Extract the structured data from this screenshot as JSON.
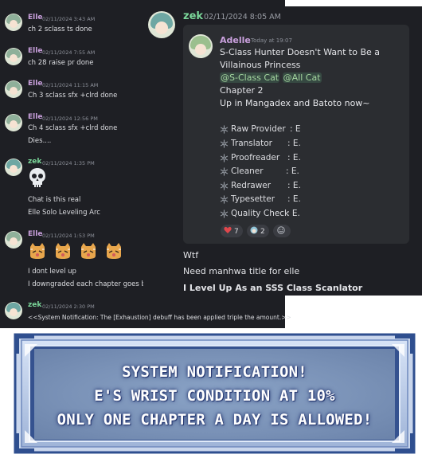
{
  "back_chat": {
    "messages": [
      {
        "author": "Elle",
        "timestamp": "02/11/2024 3:43 AM",
        "lines": [
          "ch 2 sclass ts done"
        ]
      },
      {
        "author": "Elle",
        "timestamp": "02/11/2024 7:55 AM",
        "lines": [
          "ch 28 raise pr done"
        ]
      },
      {
        "author": "Elle",
        "timestamp": "02/11/2024 11:15 AM",
        "lines": [
          "Ch 3 sclass sfx +clrd done"
        ]
      },
      {
        "author": "Elle",
        "timestamp": "02/11/2024 12:56 PM",
        "lines": [
          "Ch 4 sclass sfx +clrd done",
          "Dies...."
        ]
      },
      {
        "author": "zek",
        "timestamp": "02/11/2024 1:35 PM",
        "emoji": "skull-emoji",
        "lines": [
          "Chat is this real",
          "Elle Solo Leveling Arc"
        ]
      },
      {
        "author": "Elle",
        "timestamp": "02/11/2024 1:53 PM",
        "emoji": "cat-emoji x4",
        "lines": [
          "I dont level up",
          "I downgraded each chapter goes by"
        ]
      },
      {
        "author": "zek",
        "timestamp": "02/11/2024 2:30 PM",
        "lines": [
          "<<System Notification: The  [Exhaustion] debuff has been applied triple the amount.>>"
        ]
      }
    ]
  },
  "front_chat": {
    "author": "zek",
    "timestamp": "02/11/2024 8:05 AM",
    "embed": {
      "author": "Adelle",
      "timestamp": "Today at 19:07",
      "title_lines": [
        "S-Class Hunter Doesn't Want to Be a",
        "Villainous Princess"
      ],
      "mentions": [
        "@S-Class Cat",
        "@All Cat"
      ],
      "chapter": "Chapter 2",
      "announcement": "Up in Mangadex and Batoto now~",
      "roles": [
        {
          "name": "Raw Provider",
          "value": ": E"
        },
        {
          "name": "Translator",
          "value": ": E."
        },
        {
          "name": "Proofreader",
          "value": ": E."
        },
        {
          "name": "Cleaner",
          "value": ": E."
        },
        {
          "name": "Redrawer",
          "value": ": E."
        },
        {
          "name": "Typesetter",
          "value": ": E."
        },
        {
          "name": "Quality Check",
          "value": ": E."
        }
      ],
      "reactions": [
        {
          "icon": "heart-icon",
          "count": "7"
        },
        {
          "icon": "character-emoji-icon",
          "count": "2"
        },
        {
          "icon": "add-reaction-icon",
          "count": ""
        }
      ]
    },
    "lines": [
      "Wtf",
      "Need manhwa title for elle"
    ],
    "bold_line": "I Level Up As an SSS Class Scanlator"
  },
  "banner": {
    "lines": [
      "SYSTEM NOTIFICATION!",
      "E'S WRIST CONDITION AT 10%",
      "ONLY ONE CHAPTER A DAY IS ALLOWED!"
    ],
    "colors": {
      "frame": "#2f4f8f",
      "fill": "#7b93b8",
      "text": "#ffffff"
    }
  }
}
